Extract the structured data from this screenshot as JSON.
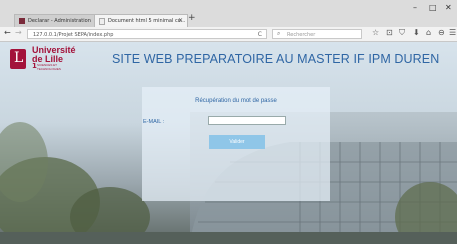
{
  "browser": {
    "tabs": [
      {
        "label": "Declarar - Administration",
        "active": false
      },
      {
        "label": "Document html 5 minimal co...",
        "active": true
      }
    ],
    "new_tab": "+",
    "url": "127.0.0.1/Projet SEPA/index.php",
    "search_placeholder": "Rechercher",
    "back": "←",
    "forward": "→",
    "reload": "C",
    "window_controls": {
      "minimize": "–",
      "maximize": "□",
      "close": "✕"
    },
    "tools": [
      "☆",
      "⊡",
      "⛉",
      "⬇",
      "⌂",
      "⊖",
      "☰"
    ]
  },
  "logo": {
    "letter": "L",
    "line1": "Université",
    "line2": "de Lille",
    "number": "1",
    "subtitle": "SCIENCES ET TECHNOLOGIES"
  },
  "page": {
    "title": "SITE WEB PREPARATOIRE AU MASTER IF IPM DUREN",
    "form": {
      "heading": "Récupération du mot de passe",
      "email_label": "E-MAIL :",
      "email_value": "",
      "submit_label": "Valider"
    }
  },
  "colors": {
    "brand": "#a3123a",
    "title_blue": "#2f66a4",
    "button": "#8fc6e8"
  }
}
